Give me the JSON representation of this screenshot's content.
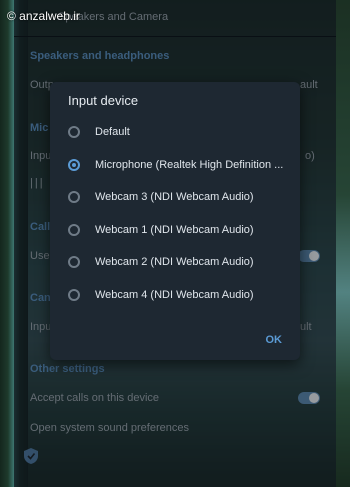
{
  "watermark": "© anzalweb.ir",
  "settings": {
    "header_title": "Speakers and Camera",
    "section_speakers": "Speakers and headphones",
    "output_label": "Outp",
    "output_value": "ault",
    "section_mic": "Mic",
    "input_label": "Inpu",
    "input_value": "o)",
    "section_calls": "Call",
    "calls_row": "Use",
    "section_camera": "Can",
    "camera_input_label": "Inpu",
    "camera_value": "ult",
    "section_other": "Other settings",
    "accept_calls": "Accept calls on this device",
    "open_prefs": "Open system sound preferences"
  },
  "dialog": {
    "title": "Input device",
    "options": [
      {
        "label": "Default",
        "selected": false
      },
      {
        "label": "Microphone (Realtek High Definition ...",
        "selected": true
      },
      {
        "label": "Webcam 3 (NDI Webcam Audio)",
        "selected": false
      },
      {
        "label": "Webcam 1 (NDI Webcam Audio)",
        "selected": false
      },
      {
        "label": "Webcam 2 (NDI Webcam Audio)",
        "selected": false
      },
      {
        "label": "Webcam 4 (NDI Webcam Audio)",
        "selected": false
      }
    ],
    "ok_label": "OK"
  },
  "colors": {
    "accent": "#5b9bd5",
    "dialog_bg": "#1e2832",
    "panel_bg": "#17212b"
  }
}
